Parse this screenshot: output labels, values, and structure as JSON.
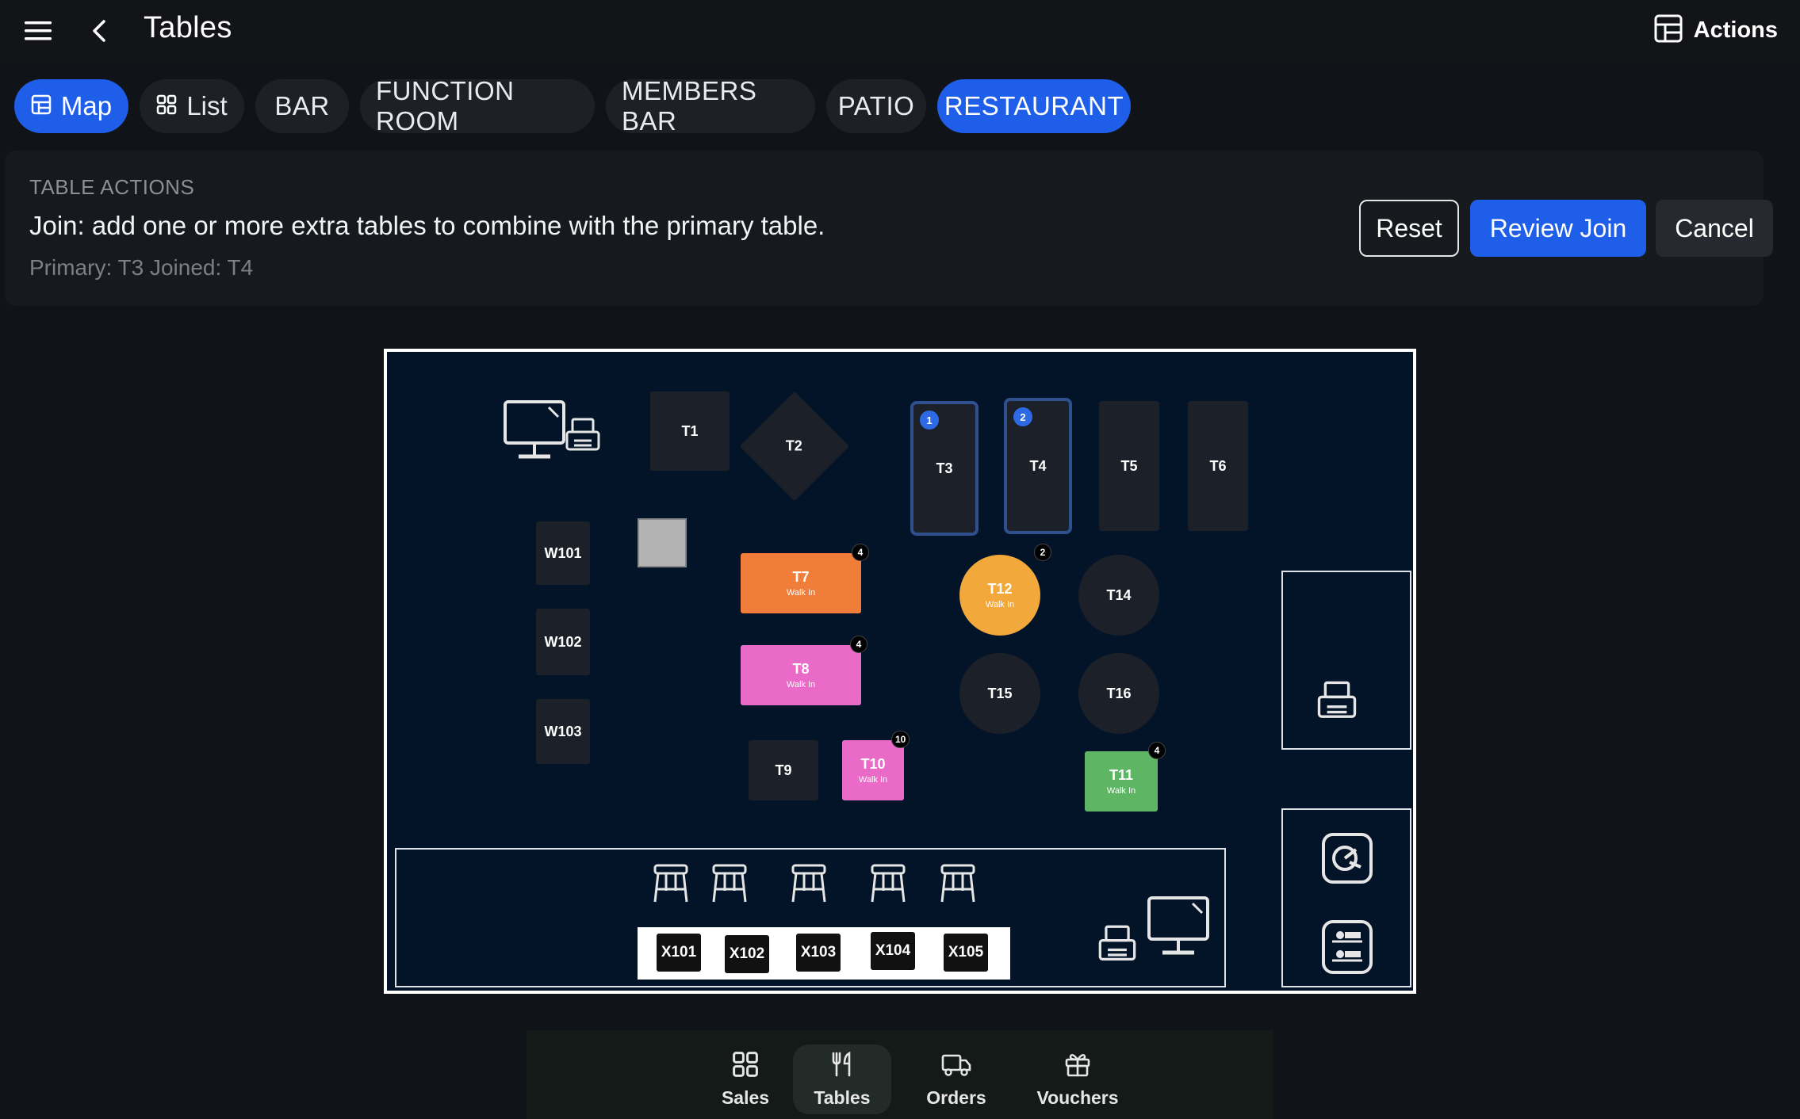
{
  "header": {
    "title": "Tables",
    "actions_label": "Actions"
  },
  "tabs": [
    {
      "label": "Map",
      "icon": "map-icon",
      "active": true
    },
    {
      "label": "List",
      "icon": "grid-icon",
      "active": false
    },
    {
      "label": "BAR",
      "active": false
    },
    {
      "label": "FUNCTION ROOM",
      "active": false
    },
    {
      "label": "MEMBERS BAR",
      "active": false
    },
    {
      "label": "PATIO",
      "active": false
    },
    {
      "label": "RESTAURANT",
      "active": true
    }
  ],
  "table_actions": {
    "heading": "TABLE ACTIONS",
    "description": "Join: add one or more extra tables to combine with the primary table.",
    "status": "Primary: T3 Joined: T4",
    "reset_label": "Reset",
    "review_label": "Review Join",
    "cancel_label": "Cancel"
  },
  "map": {
    "tables": {
      "T1": {
        "label": "T1"
      },
      "T2": {
        "label": "T2"
      },
      "T3": {
        "label": "T3",
        "join_order": "1"
      },
      "T4": {
        "label": "T4",
        "join_order": "2"
      },
      "T5": {
        "label": "T5"
      },
      "T6": {
        "label": "T6"
      },
      "T7": {
        "label": "T7",
        "status": "Walk In",
        "covers": "4",
        "color": "#f07d3a"
      },
      "T8": {
        "label": "T8",
        "status": "Walk In",
        "covers": "4",
        "color": "#ea6ac8"
      },
      "T9": {
        "label": "T9"
      },
      "T10": {
        "label": "T10",
        "status": "Walk In",
        "covers": "10",
        "color": "#ea6ac8"
      },
      "T11": {
        "label": "T11",
        "status": "Walk In",
        "covers": "4",
        "color": "#5eb563"
      },
      "T12": {
        "label": "T12",
        "status": "Walk In",
        "covers": "2",
        "color": "#f2a83a"
      },
      "T14": {
        "label": "T14"
      },
      "T15": {
        "label": "T15"
      },
      "T16": {
        "label": "T16"
      },
      "W101": {
        "label": "W101"
      },
      "W102": {
        "label": "W102"
      },
      "W103": {
        "label": "W103"
      },
      "X101": {
        "label": "X101"
      },
      "X102": {
        "label": "X102"
      },
      "X103": {
        "label": "X103"
      },
      "X104": {
        "label": "X104"
      },
      "X105": {
        "label": "X105"
      }
    },
    "icons": [
      "monitor-icon",
      "printer-icon",
      "bar-stool-icon",
      "pos-terminal-icon",
      "restroom-icon"
    ]
  },
  "bottom_nav": [
    {
      "label": "Sales",
      "icon": "grid-icon",
      "active": false
    },
    {
      "label": "Tables",
      "icon": "fork-knife-icon",
      "active": true
    },
    {
      "label": "Orders",
      "icon": "delivery-truck-icon",
      "active": false
    },
    {
      "label": "Vouchers",
      "icon": "gift-icon",
      "active": false
    }
  ]
}
